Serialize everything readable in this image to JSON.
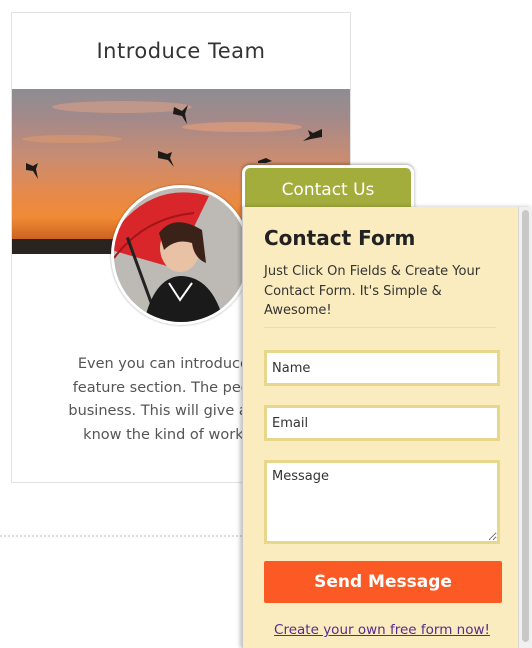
{
  "team_card": {
    "title": "Introduce Team",
    "text_lines": [
      "Even you can introduce your",
      "feature section. The people th",
      "business. This will give a chanc",
      "know the kind of work your"
    ]
  },
  "contact_widget": {
    "tab_label": "Contact Us",
    "title": "Contact Form",
    "description": "Just Click On Fields & Create Your Contact Form. It's Simple & Awesome!",
    "fields": {
      "name_placeholder": "Name",
      "email_placeholder": "Email",
      "message_placeholder": "Message"
    },
    "submit_label": "Send Message",
    "footer_link": "Create your own free form now!"
  },
  "colors": {
    "tab_green": "#a3ad3c",
    "panel_bg": "#faecbe",
    "button_orange": "#fb5a24",
    "link_purple": "#5a2a8c"
  }
}
